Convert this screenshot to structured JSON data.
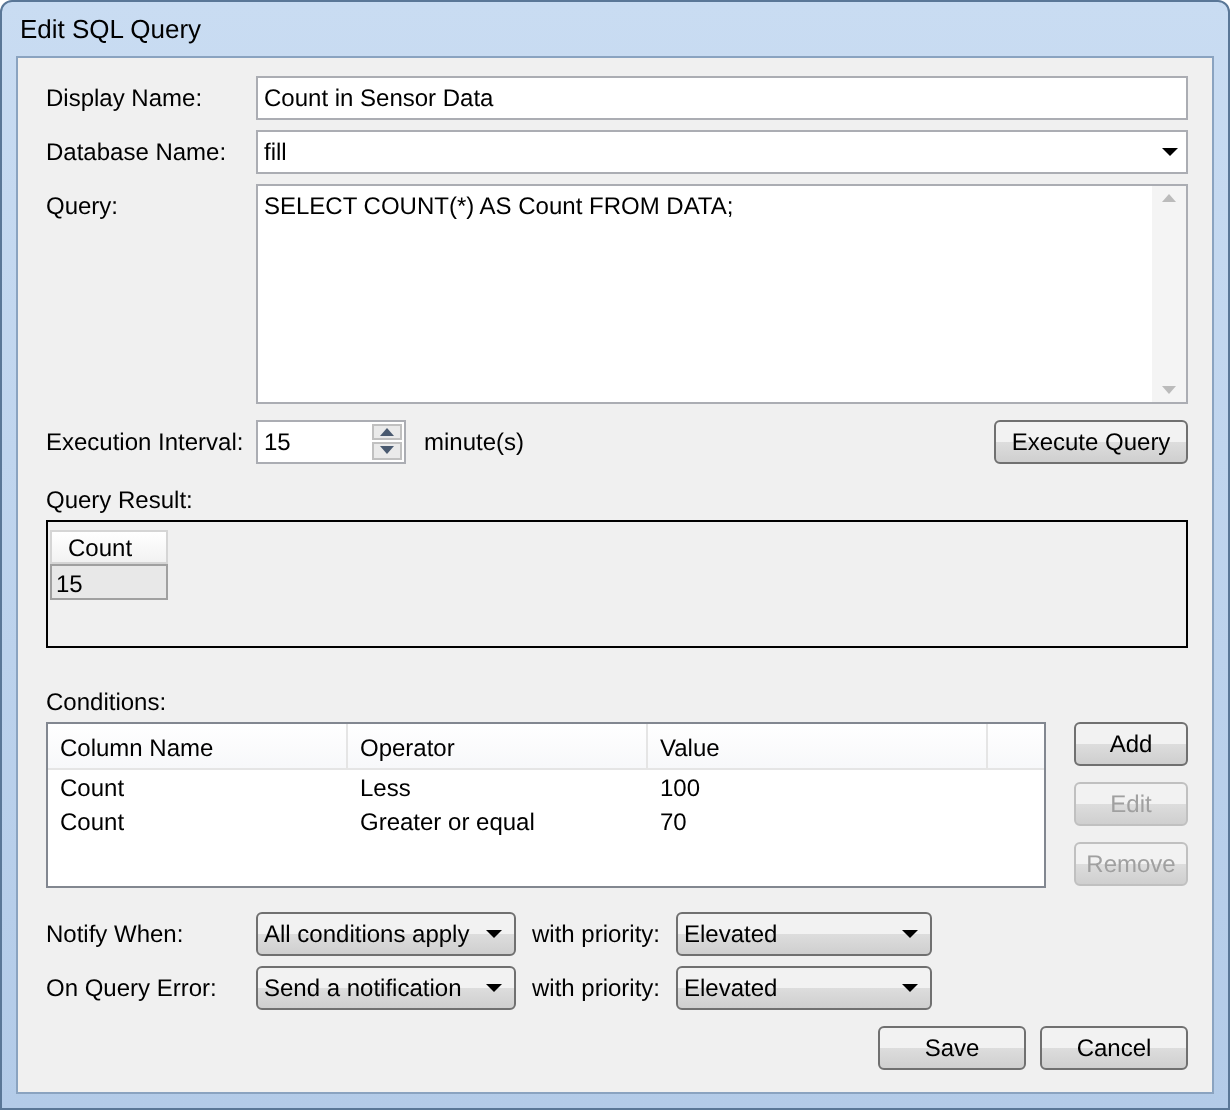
{
  "window": {
    "title": "Edit SQL Query"
  },
  "display_name": {
    "label": "Display Name:",
    "value": "Count in Sensor Data"
  },
  "database_name": {
    "label": "Database Name:",
    "value": "fill"
  },
  "query": {
    "label": "Query:",
    "value": "SELECT COUNT(*) AS Count FROM DATA;"
  },
  "execution_interval": {
    "label": "Execution Interval:",
    "value": "15",
    "unit": "minute(s)"
  },
  "execute_button": {
    "label": "Execute Query",
    "disabled": false
  },
  "query_result": {
    "label": "Query Result:",
    "columns": [
      "Count"
    ],
    "rows": [
      [
        "15"
      ]
    ]
  },
  "conditions": {
    "label": "Conditions:",
    "columns": [
      "Column Name",
      "Operator",
      "Value"
    ],
    "rows": [
      [
        "Count",
        "Less",
        "100"
      ],
      [
        "Count",
        "Greater or equal",
        "70"
      ]
    ],
    "buttons": [
      {
        "label": "Add",
        "disabled": false
      },
      {
        "label": "Edit",
        "disabled": true
      },
      {
        "label": "Remove",
        "disabled": true
      }
    ]
  },
  "options": [
    {
      "label": "Notify When:",
      "value": "All conditions apply",
      "priority_label": "with priority:",
      "priority": "Elevated"
    },
    {
      "label": "On Query Error:",
      "value": "Send a notification",
      "priority_label": "with priority:",
      "priority": "Elevated"
    }
  ],
  "buttons": [
    {
      "label": "Save",
      "disabled": false
    },
    {
      "label": "Cancel",
      "disabled": false
    }
  ]
}
